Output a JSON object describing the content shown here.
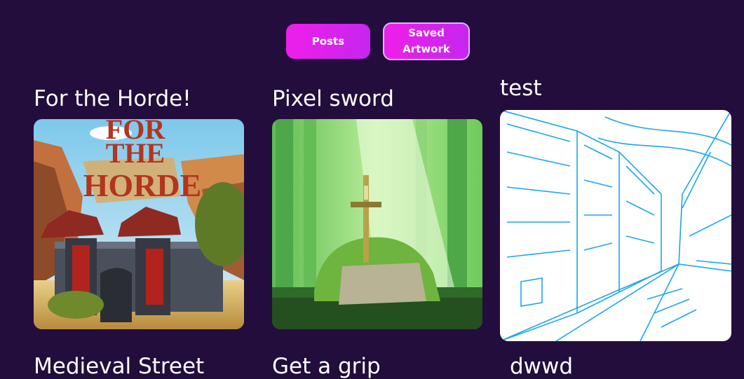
{
  "tabs": {
    "posts_label": "Posts",
    "saved_label": "Saved Artwork"
  },
  "cards": [
    {
      "title": "For the Horde!",
      "image_text": [
        "FOR",
        "THE",
        "HORDE"
      ]
    },
    {
      "title": "Pixel sword"
    },
    {
      "title": "test"
    },
    {
      "title": "Medieval Street"
    },
    {
      "title": "Get a grip"
    },
    {
      "title": "dwwd"
    }
  ]
}
